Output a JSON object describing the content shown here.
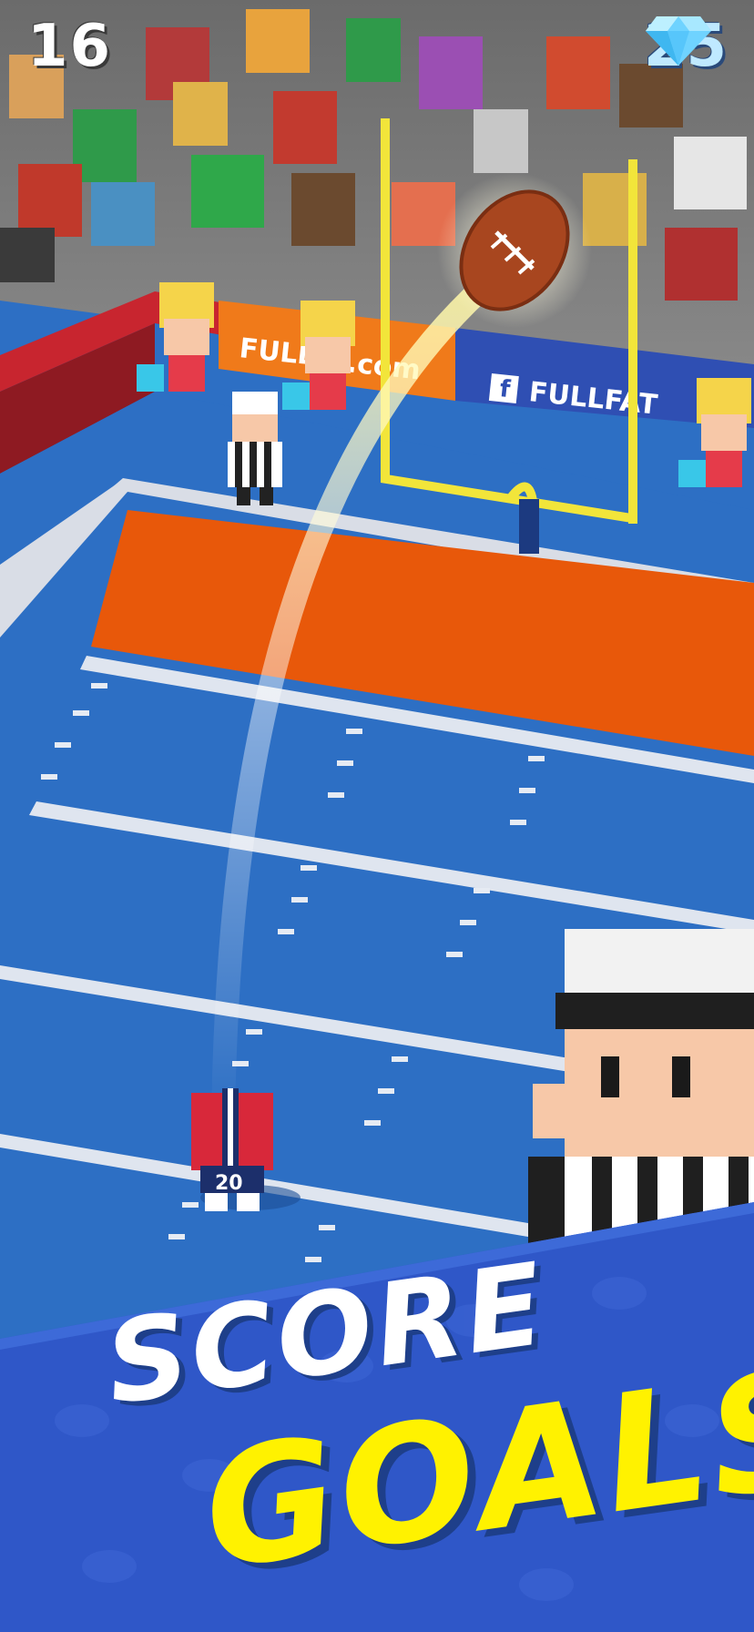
{
  "hud": {
    "score": "16",
    "gem_count": "25",
    "gem_icon": "diamond-icon"
  },
  "stadium": {
    "banner_left_text": "FULLFA",
    "banner_left_suffix": ".com",
    "banner_right_text": "FULLFAT",
    "banner_right_icon": "facebook-icon"
  },
  "player": {
    "jersey_number": "20"
  },
  "promo": {
    "line1": "SCORE",
    "line2": "GOALS"
  },
  "colors": {
    "field_blue": "#2d6fc4",
    "endzone_orange": "#e8580a",
    "goalpost_yellow": "#f2e53a",
    "promo_yellow": "#fff200",
    "promo_band_blue": "#2f57c8"
  }
}
